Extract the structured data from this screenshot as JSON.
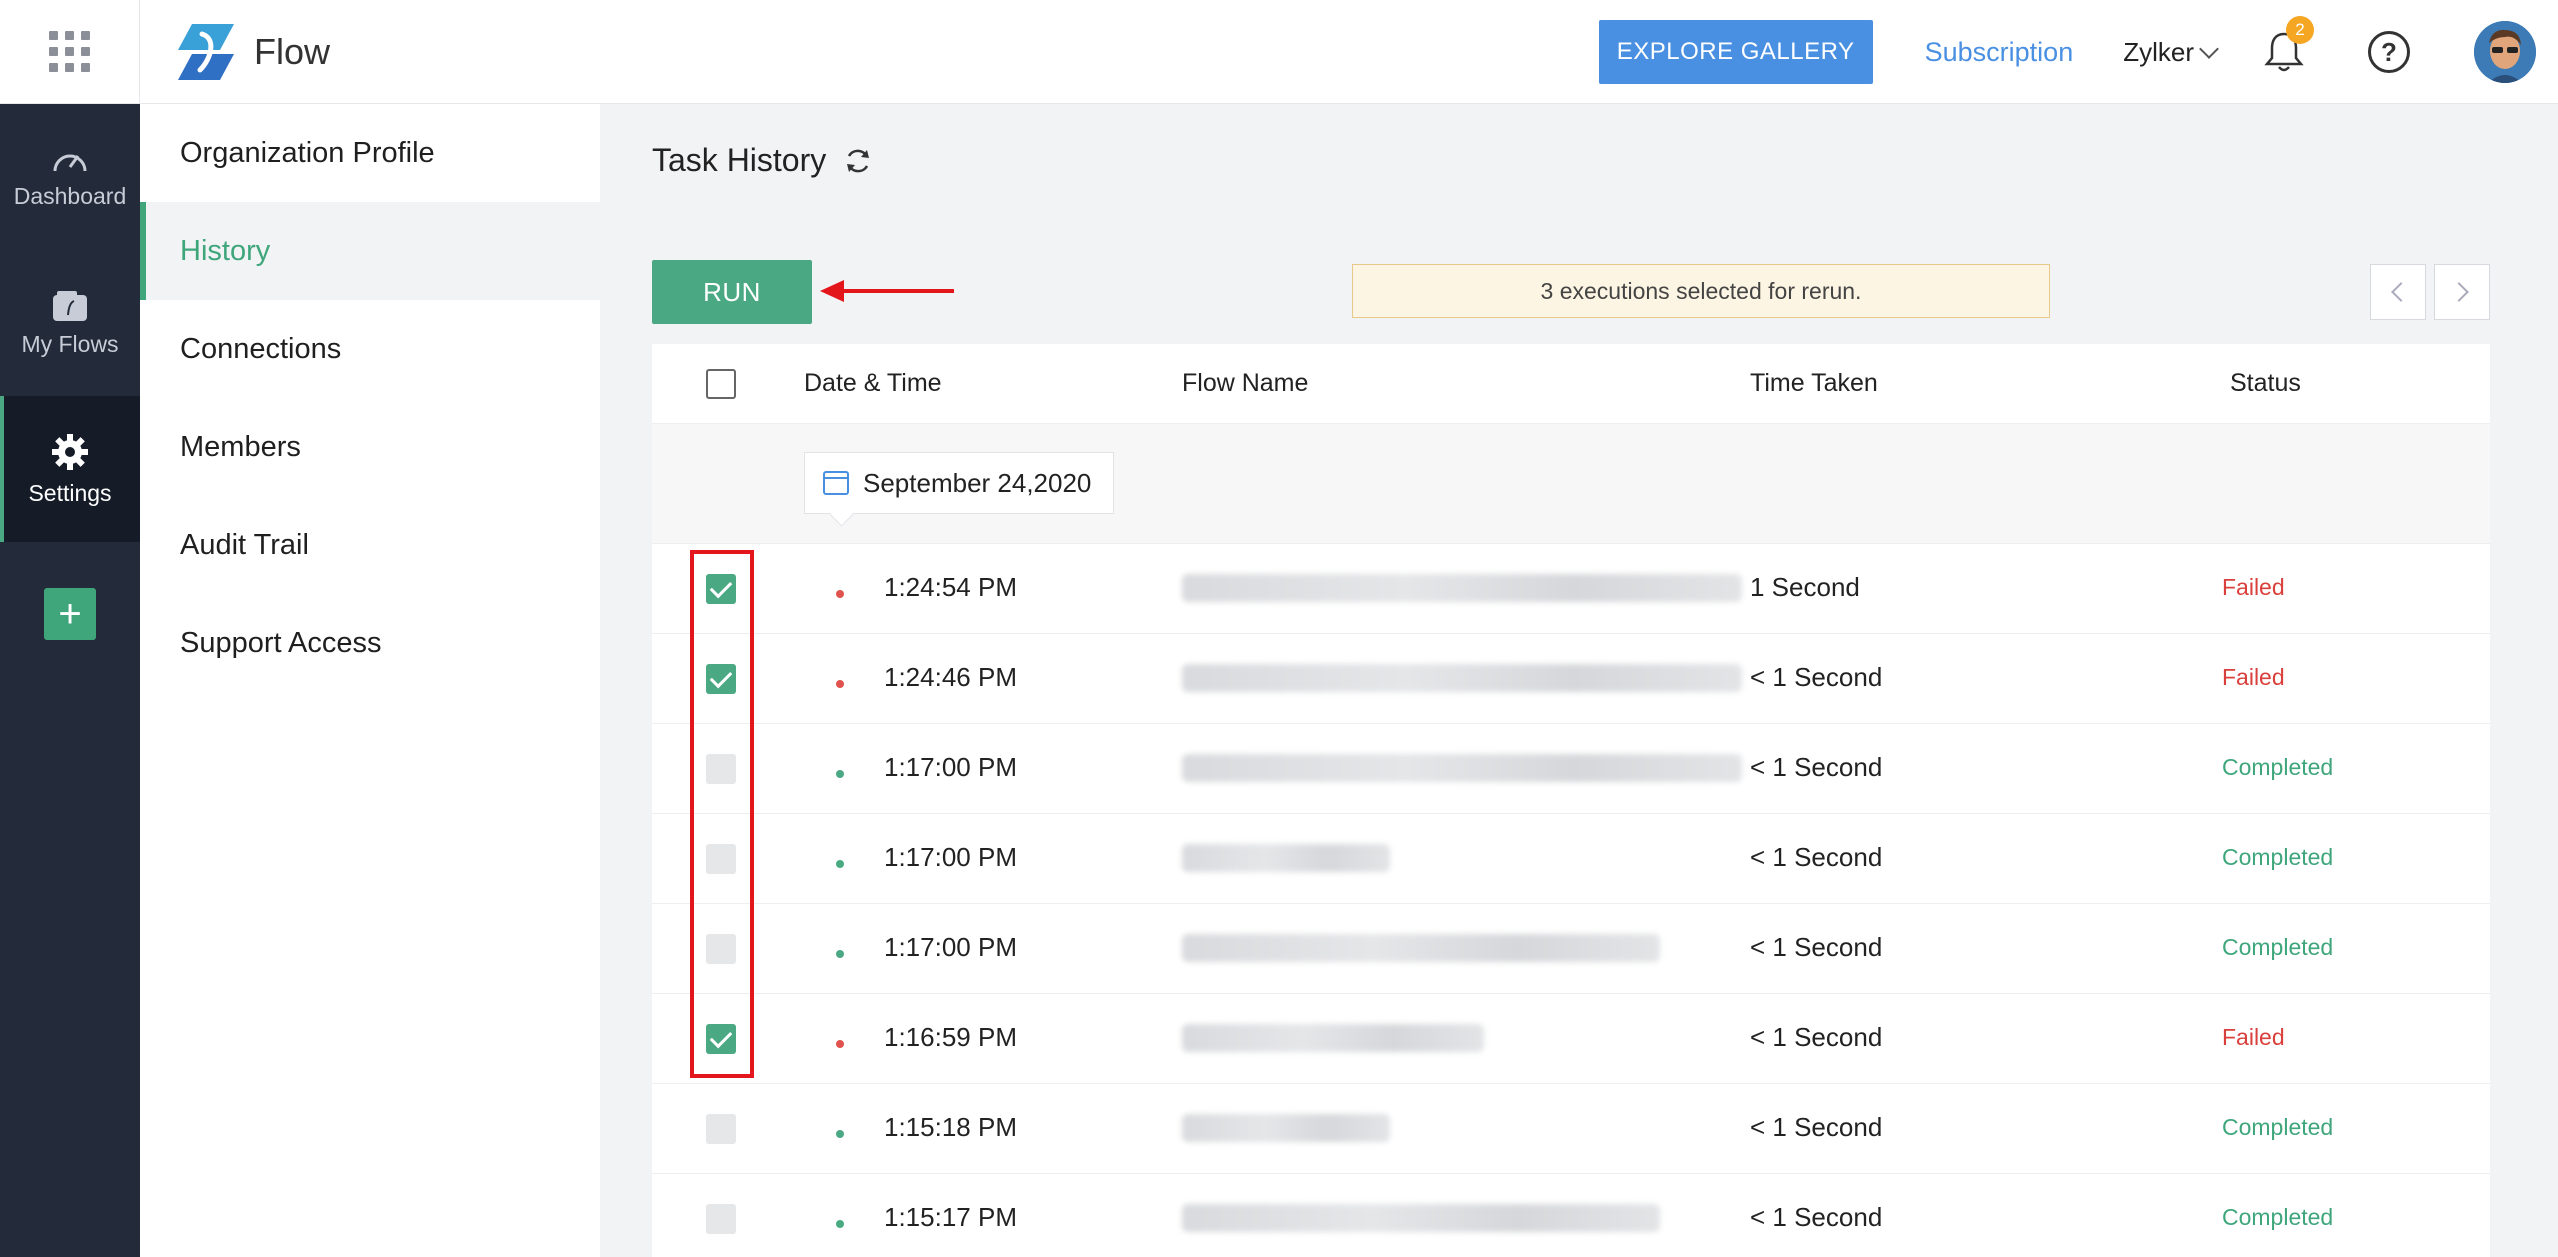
{
  "topbar": {
    "app_name": "Flow",
    "explore_label": "EXPLORE GALLERY",
    "subscription_label": "Subscription",
    "org_name": "Zylker",
    "notification_count": "2",
    "help_label": "?"
  },
  "leftnav": {
    "items": [
      {
        "label": "Dashboard",
        "icon": "speedometer-icon"
      },
      {
        "label": "My Flows",
        "icon": "flow-folder-icon"
      },
      {
        "label": "Settings",
        "icon": "gear-icon"
      }
    ],
    "add_label": "+"
  },
  "subnav": {
    "items": [
      {
        "label": "Organization Profile"
      },
      {
        "label": "History"
      },
      {
        "label": "Connections"
      },
      {
        "label": "Members"
      },
      {
        "label": "Audit Trail"
      },
      {
        "label": "Support Access"
      }
    ],
    "active_index": 1
  },
  "main": {
    "title": "Task History",
    "run_label": "RUN",
    "notice": "3 executions selected for rerun.",
    "table": {
      "headers": {
        "date": "Date & Time",
        "flow": "Flow Name",
        "time": "Time Taken",
        "status": "Status"
      },
      "date_group": "September 24,2020",
      "rows": [
        {
          "time": "1:24:54 PM",
          "taken": "1 Second",
          "status": "Failed",
          "checked": true
        },
        {
          "time": "1:24:46 PM",
          "taken": "< 1 Second",
          "status": "Failed",
          "checked": true
        },
        {
          "time": "1:17:00 PM",
          "taken": "< 1 Second",
          "status": "Completed",
          "checked": false
        },
        {
          "time": "1:17:00 PM",
          "taken": "< 1 Second",
          "status": "Completed",
          "checked": false
        },
        {
          "time": "1:17:00 PM",
          "taken": "< 1 Second",
          "status": "Completed",
          "checked": false
        },
        {
          "time": "1:16:59 PM",
          "taken": "< 1 Second",
          "status": "Failed",
          "checked": true
        },
        {
          "time": "1:15:18 PM",
          "taken": "< 1 Second",
          "status": "Completed",
          "checked": false
        },
        {
          "time": "1:15:17 PM",
          "taken": "< 1 Second",
          "status": "Completed",
          "checked": false
        }
      ]
    }
  },
  "colors": {
    "accent_green": "#4aa982",
    "accent_blue": "#4a90e2",
    "failed_red": "#d9403c",
    "nav_dark": "#232b3b",
    "annotation_red": "#e3161b"
  }
}
